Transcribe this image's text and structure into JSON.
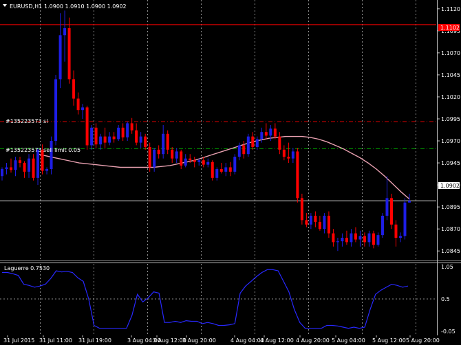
{
  "window": {
    "symbol_timeframe": "EURUSD,H1",
    "ohlc_text": "1.0900 1.0910 1.0900 1.0902",
    "menu_icon": "triangle-down-icon"
  },
  "colors": {
    "background": "#000000",
    "bull_candle": "#1e1ee6",
    "bear_candle": "#ff0000",
    "doji_candle": "#00c800",
    "moving_average": "#e8a0b0",
    "stop_loss_line": "#c80000",
    "take_profit_line": "#00a000",
    "red_level_line": "#ff0000",
    "bid_line": "#c0c0c0",
    "grid": "#ffffff",
    "laguerre_line": "#2828ff"
  },
  "orders": {
    "sl_label": "#135223573 sl",
    "tp_label": "#135223573 sell limit 0.05"
  },
  "price_tags": {
    "red_level": "1.1102",
    "bid": "1.0902"
  },
  "chart_data": {
    "type": "candlestick",
    "symbol": "EURUSD",
    "timeframe": "H1",
    "y_axis_labels": [
      "1.1120",
      "1.1095",
      "1.1070",
      "1.1045",
      "1.1020",
      "1.0995",
      "1.0970",
      "1.0945",
      "1.0920",
      "1.0895",
      "1.0870",
      "1.0845"
    ],
    "ylim": [
      1.0835,
      1.113
    ],
    "x_axis_labels": [
      "31 Jul 2015",
      "31 Jul 11:00",
      "31 Jul 19:00",
      "3 Aug 04:00",
      "3 Aug 12:00",
      "3 Aug 20:00",
      "4 Aug 04:00",
      "4 Aug 12:00",
      "4 Aug 20:00",
      "5 Aug 04:00",
      "5 Aug 12:00",
      "5 Aug 20:00"
    ],
    "levels": {
      "red_level": 1.1102,
      "stop_loss": 1.0992,
      "sell_limit": 1.0961,
      "bid": 1.0902
    },
    "candles": [
      [
        1.093,
        1.094,
        1.0925,
        1.0938
      ],
      [
        1.0938,
        1.0945,
        1.0932,
        1.094
      ],
      [
        1.094,
        1.095,
        1.0934,
        1.0937
      ],
      [
        1.0937,
        1.0952,
        1.093,
        1.0948
      ],
      [
        1.0948,
        1.0952,
        1.094,
        1.0945
      ],
      [
        1.0945,
        1.0947,
        1.0928,
        1.0935
      ],
      [
        1.0935,
        1.0955,
        1.0928,
        1.095
      ],
      [
        1.095,
        1.0955,
        1.0925,
        1.0928
      ],
      [
        1.0928,
        1.0962,
        1.092,
        1.096
      ],
      [
        1.096,
        1.0966,
        1.0932,
        1.0936
      ],
      [
        1.0936,
        1.094,
        1.0932,
        1.0938
      ],
      [
        1.0938,
        1.0975,
        1.0932,
        1.097
      ],
      [
        1.097,
        1.1045,
        1.0965,
        1.104
      ],
      [
        1.104,
        1.1115,
        1.103,
        1.109
      ],
      [
        1.109,
        1.1118,
        1.106,
        1.1098
      ],
      [
        1.1098,
        1.111,
        1.1035,
        1.104
      ],
      [
        1.104,
        1.105,
        1.101,
        1.1018
      ],
      [
        1.1018,
        1.1025,
        1.1,
        1.1005
      ],
      [
        1.1005,
        1.1012,
        1.0995,
        1.1008
      ],
      [
        1.1008,
        1.101,
        1.096,
        1.0965
      ],
      [
        1.0965,
        1.0988,
        1.096,
        1.0985
      ],
      [
        1.0985,
        1.099,
        1.0962,
        1.0966
      ],
      [
        1.0966,
        1.0978,
        1.096,
        1.0975
      ],
      [
        1.0975,
        1.0985,
        1.0962,
        1.0968
      ],
      [
        1.0968,
        1.098,
        1.0965,
        1.0975
      ],
      [
        1.0975,
        1.098,
        1.0968,
        1.0972
      ],
      [
        1.0972,
        1.0988,
        1.097,
        1.0985
      ],
      [
        1.0985,
        1.099,
        1.097,
        1.0974
      ],
      [
        1.0974,
        1.0992,
        1.097,
        1.099
      ],
      [
        1.099,
        1.0996,
        1.0978,
        1.0982
      ],
      [
        1.0982,
        1.099,
        1.0965,
        1.0968
      ],
      [
        1.0968,
        1.098,
        1.0962,
        1.0975
      ],
      [
        1.0975,
        1.0978,
        1.096,
        1.0963
      ],
      [
        1.0963,
        1.0968,
        1.0935,
        1.094
      ],
      [
        1.094,
        1.0962,
        1.0935,
        1.096
      ],
      [
        1.096,
        1.0965,
        1.095,
        1.0955
      ],
      [
        1.0955,
        1.0988,
        1.095,
        1.0978
      ],
      [
        1.0978,
        1.0982,
        1.0955,
        1.096
      ],
      [
        1.096,
        1.0963,
        1.0945,
        1.095
      ],
      [
        1.095,
        1.0962,
        1.0945,
        1.0958
      ],
      [
        1.0958,
        1.096,
        1.0938,
        1.0942
      ],
      [
        1.0942,
        1.0955,
        1.094,
        1.095
      ],
      [
        1.095,
        1.0955,
        1.0945,
        1.0948
      ],
      [
        1.0948,
        1.0952,
        1.094,
        1.0946
      ],
      [
        1.0946,
        1.095,
        1.0942,
        1.0948
      ],
      [
        1.0948,
        1.0952,
        1.094,
        1.0943
      ],
      [
        1.0943,
        1.095,
        1.094,
        1.0946
      ],
      [
        1.0946,
        1.0948,
        1.0925,
        1.0928
      ],
      [
        1.0928,
        1.094,
        1.0925,
        1.0938
      ],
      [
        1.0938,
        1.0945,
        1.0933,
        1.0935
      ],
      [
        1.0935,
        1.0945,
        1.093,
        1.094
      ],
      [
        1.094,
        1.0946,
        1.093,
        1.0935
      ],
      [
        1.0935,
        1.0955,
        1.0932,
        1.0952
      ],
      [
        1.0952,
        1.0968,
        1.0948,
        1.0965
      ],
      [
        1.0965,
        1.097,
        1.095,
        1.0955
      ],
      [
        1.0955,
        1.0978,
        1.0952,
        1.0975
      ],
      [
        1.0975,
        1.098,
        1.096,
        1.0963
      ],
      [
        1.0963,
        1.0975,
        1.096,
        1.0972
      ],
      [
        1.0972,
        1.0985,
        1.0968,
        1.098
      ],
      [
        1.098,
        1.099,
        1.0972,
        1.0976
      ],
      [
        1.0976,
        1.0988,
        1.097,
        1.0984
      ],
      [
        1.0984,
        1.099,
        1.0972,
        1.0975
      ],
      [
        1.0975,
        1.098,
        1.0955,
        1.096
      ],
      [
        1.096,
        1.0965,
        1.0948,
        1.0952
      ],
      [
        1.0952,
        1.0968,
        1.0945,
        1.095
      ],
      [
        1.095,
        1.0962,
        1.0945,
        1.0958
      ],
      [
        1.0958,
        1.0962,
        1.09,
        1.0905
      ],
      [
        1.0905,
        1.091,
        1.0875,
        1.088
      ],
      [
        1.088,
        1.0888,
        1.0872,
        1.0875
      ],
      [
        1.0875,
        1.0888,
        1.087,
        1.0885
      ],
      [
        1.0885,
        1.089,
        1.0872,
        1.0878
      ],
      [
        1.0878,
        1.0885,
        1.0868,
        1.087
      ],
      [
        1.087,
        1.0888,
        1.0865,
        1.0885
      ],
      [
        1.0885,
        1.089,
        1.086,
        1.0865
      ],
      [
        1.0865,
        1.087,
        1.085,
        1.0855
      ],
      [
        1.0855,
        1.086,
        1.0845,
        1.0856
      ],
      [
        1.0856,
        1.0865,
        1.085,
        1.086
      ],
      [
        1.086,
        1.0868,
        1.0852,
        1.0855
      ],
      [
        1.0855,
        1.087,
        1.085,
        1.0865
      ],
      [
        1.0865,
        1.0872,
        1.0855,
        1.0858
      ],
      [
        1.0858,
        1.0868,
        1.085,
        1.0862
      ],
      [
        1.0862,
        1.0866,
        1.085,
        1.0855
      ],
      [
        1.0855,
        1.0868,
        1.085,
        1.0865
      ],
      [
        1.0865,
        1.0868,
        1.0848,
        1.0852
      ],
      [
        1.0852,
        1.0866,
        1.085,
        1.0863
      ],
      [
        1.0863,
        1.0888,
        1.086,
        1.0885
      ],
      [
        1.0885,
        1.093,
        1.088,
        1.0905
      ],
      [
        1.0905,
        1.091,
        1.087,
        1.0875
      ],
      [
        1.0875,
        1.088,
        1.085,
        1.086
      ],
      [
        1.086,
        1.0866,
        1.0855,
        1.0862
      ],
      [
        1.0862,
        1.0905,
        1.0858,
        1.09
      ],
      [
        1.09,
        1.091,
        1.09,
        1.0902
      ]
    ],
    "moving_average": [
      1.0955,
      1.0953,
      1.0951,
      1.0949,
      1.0947,
      1.0945,
      1.0944,
      1.0943,
      1.0942,
      1.0941,
      1.094,
      1.094,
      1.094,
      1.094,
      1.094,
      1.0941,
      1.0942,
      1.0944,
      1.0946,
      1.0948,
      1.0951,
      1.0954,
      1.0957,
      1.096,
      1.0963,
      1.0966,
      1.0969,
      1.0971,
      1.0973,
      1.0974,
      1.0975,
      1.0975,
      1.0975,
      1.0974,
      1.0972,
      1.0969,
      1.0965,
      1.0961,
      1.0956,
      1.0951,
      1.0945,
      1.0938,
      1.093,
      1.0921,
      1.0912,
      1.0904
    ],
    "laguerre": {
      "label": "Laguerre 0.7530",
      "y_axis_labels": [
        "1.05",
        "0.5",
        "-0.05"
      ],
      "ylim": [
        -0.05,
        1.05
      ],
      "levels": [
        0.5
      ],
      "values": [
        0.95,
        0.95,
        0.93,
        0.9,
        0.75,
        0.73,
        0.7,
        0.72,
        0.75,
        0.85,
        0.98,
        0.96,
        0.97,
        0.95,
        0.86,
        0.8,
        0.5,
        0.05,
        0.0,
        0.0,
        0.0,
        0.0,
        0.0,
        0.0,
        0.22,
        0.58,
        0.45,
        0.52,
        0.62,
        0.6,
        0.1,
        0.1,
        0.12,
        0.1,
        0.13,
        0.12,
        0.12,
        0.08,
        0.1,
        0.08,
        0.05,
        0.05,
        0.06,
        0.08,
        0.6,
        0.72,
        0.8,
        0.88,
        0.95,
        1.0,
        1.0,
        0.98,
        0.8,
        0.62,
        0.32,
        0.1,
        0.0,
        0.0,
        0.0,
        0.0,
        0.05,
        0.05,
        0.04,
        0.02,
        0.0,
        0.02,
        0.0,
        0.02,
        0.32,
        0.58,
        0.65,
        0.7,
        0.75,
        0.73,
        0.7,
        0.72
      ]
    }
  }
}
